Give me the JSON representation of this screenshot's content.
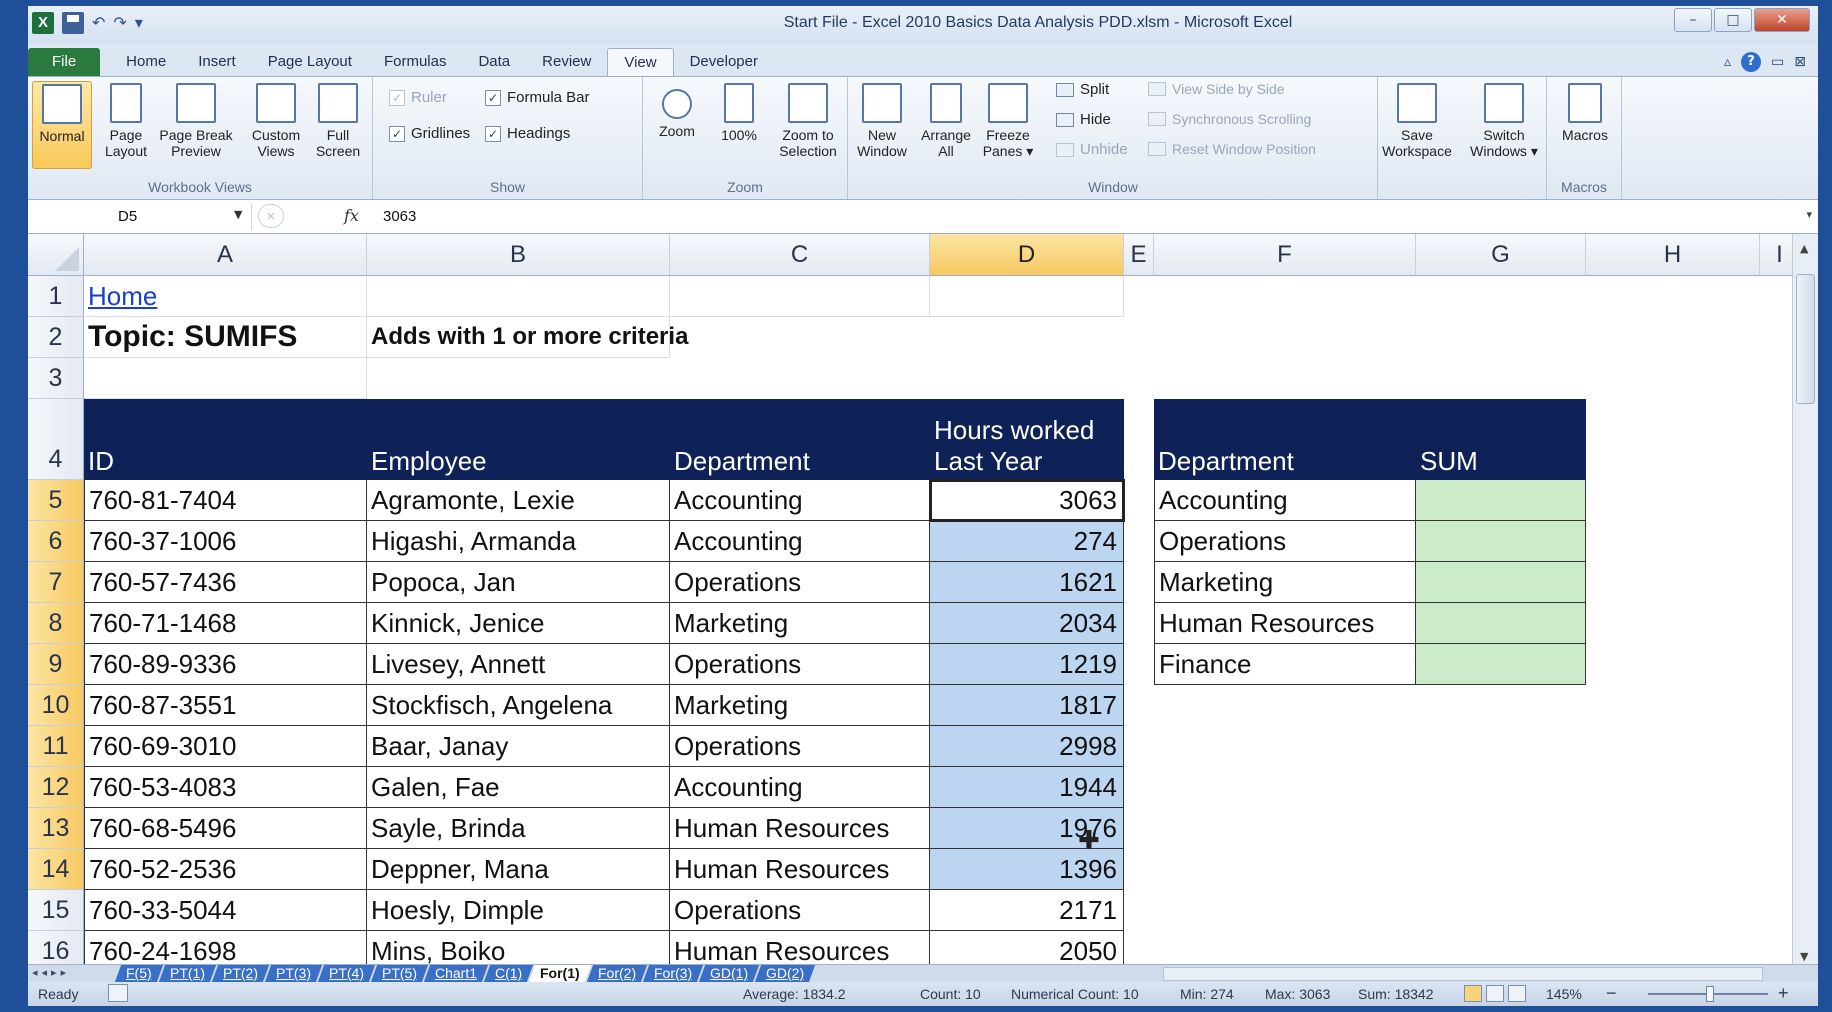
{
  "window": {
    "title": "Start File - Excel 2010 Basics Data Analysis PDD.xlsm - Microsoft Excel",
    "minimize": "–",
    "maximize": "□",
    "close": "✕"
  },
  "qat": {
    "logo": "X",
    "undo": "↶",
    "redo": "↷",
    "more": "▾"
  },
  "ribbon": {
    "tabs": [
      "File",
      "Home",
      "Insert",
      "Page Layout",
      "Formulas",
      "Data",
      "Review",
      "View",
      "Developer"
    ],
    "active_tab": "View",
    "help": "?",
    "workbook_views": {
      "label": "Workbook Views",
      "normal": "Normal",
      "page_layout": "Page Layout",
      "page_break": "Page Break Preview",
      "custom_views": "Custom Views",
      "full_screen": "Full Screen"
    },
    "show": {
      "label": "Show",
      "ruler": "Ruler",
      "formula_bar": "Formula Bar",
      "gridlines": "Gridlines",
      "headings": "Headings",
      "check": "✓"
    },
    "zoom": {
      "label": "Zoom",
      "zoom": "Zoom",
      "hundred": "100%",
      "zoom_to_selection": "Zoom to Selection"
    },
    "window": {
      "label": "Window",
      "new_window": "New Window",
      "arrange_all": "Arrange All",
      "freeze_panes": "Freeze Panes ▾",
      "split": "Split",
      "hide": "Hide",
      "unhide": "Unhide",
      "view_side_by_side": "View Side by Side",
      "sync_scrolling": "Synchronous Scrolling",
      "reset_position": "Reset Window Position",
      "save_workspace": "Save Workspace",
      "switch_windows": "Switch Windows ▾"
    },
    "macros": {
      "label": "Macros",
      "macros": "Macros"
    }
  },
  "formula_bar": {
    "name_box": "D5",
    "fx": "fx",
    "cancel": "×",
    "value": "3063"
  },
  "columns": [
    "A",
    "B",
    "C",
    "D",
    "E",
    "F",
    "G",
    "H",
    "I"
  ],
  "selected_column": "D",
  "sheet": {
    "a1": "Home",
    "a2": "Topic: SUMIFS",
    "b2": "Adds with 1 or more criteria",
    "headers": {
      "id": "ID",
      "employee": "Employee",
      "department": "Department",
      "hours_line1": "Hours worked",
      "hours_line2": "Last Year"
    },
    "summary_headers": {
      "department": "Department",
      "sum": "SUM"
    },
    "rows": [
      {
        "n": "5",
        "id": "760-81-7404",
        "employee": "Agramonte, Lexie",
        "department": "Accounting",
        "hours": "3063"
      },
      {
        "n": "6",
        "id": "760-37-1006",
        "employee": "Higashi, Armanda",
        "department": "Accounting",
        "hours": "274"
      },
      {
        "n": "7",
        "id": "760-57-7436",
        "employee": "Popoca, Jan",
        "department": "Operations",
        "hours": "1621"
      },
      {
        "n": "8",
        "id": "760-71-1468",
        "employee": "Kinnick, Jenice",
        "department": "Marketing",
        "hours": "2034"
      },
      {
        "n": "9",
        "id": "760-89-9336",
        "employee": "Livesey, Annett",
        "department": "Operations",
        "hours": "1219"
      },
      {
        "n": "10",
        "id": "760-87-3551",
        "employee": "Stockfisch, Angelena",
        "department": "Marketing",
        "hours": "1817"
      },
      {
        "n": "11",
        "id": "760-69-3010",
        "employee": "Baar, Janay",
        "department": "Operations",
        "hours": "2998"
      },
      {
        "n": "12",
        "id": "760-53-4083",
        "employee": "Galen, Fae",
        "department": "Accounting",
        "hours": "1944"
      },
      {
        "n": "13",
        "id": "760-68-5496",
        "employee": "Sayle, Brinda",
        "department": "Human Resources",
        "hours": "1976"
      },
      {
        "n": "14",
        "id": "760-52-2536",
        "employee": "Deppner, Mana",
        "department": "Human Resources",
        "hours": "1396"
      },
      {
        "n": "15",
        "id": "760-33-5044",
        "employee": "Hoesly, Dimple",
        "department": "Operations",
        "hours": "2171"
      },
      {
        "n": "16",
        "id": "760-24-1698",
        "employee": "Mins, Boiko",
        "department": "Human Resources",
        "hours": "2050"
      }
    ],
    "summary_departments": [
      "Accounting",
      "Operations",
      "Marketing",
      "Human Resources",
      "Finance"
    ]
  },
  "sheet_tabs": [
    "F(5)",
    "PT(1)",
    "PT(2)",
    "PT(3)",
    "PT(4)",
    "PT(5)",
    "Chart1",
    "C(1)",
    "For(1)",
    "For(2)",
    "For(3)",
    "GD(1)",
    "GD(2)"
  ],
  "active_sheet": "For(1)",
  "status": {
    "ready": "Ready",
    "average": "Average: 1834.2",
    "count": "Count: 10",
    "numerical_count": "Numerical Count: 10",
    "min": "Min: 274",
    "max": "Max: 3063",
    "sum": "Sum: 18342",
    "zoom": "145%",
    "zoom_minus": "−",
    "zoom_plus": "+"
  },
  "colors": {
    "header_fill": "#0e2257",
    "highlight": "#bcd6f2",
    "sum_fill": "#ccebc8",
    "active_tab": "#2a7a3f"
  }
}
